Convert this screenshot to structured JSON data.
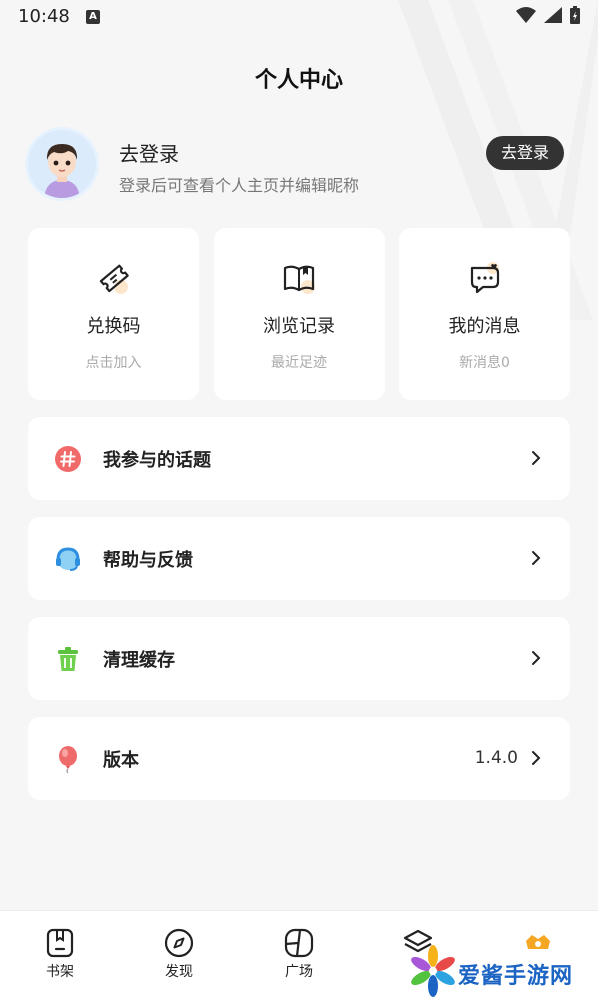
{
  "status_bar": {
    "time": "10:48",
    "notif_badge": "A"
  },
  "page_title": "个人中心",
  "profile": {
    "name": "去登录",
    "subtitle": "登录后可查看个人主页并编辑昵称",
    "login_button": "去登录"
  },
  "cards": [
    {
      "title": "兑换码",
      "subtitle": "点击加入",
      "icon": "ticket-icon"
    },
    {
      "title": "浏览记录",
      "subtitle": "最近足迹",
      "icon": "book-icon"
    },
    {
      "title": "我的消息",
      "subtitle": "新消息0",
      "icon": "message-icon"
    }
  ],
  "menu": [
    {
      "label": "我参与的话题",
      "icon": "hashtag-icon",
      "value": ""
    },
    {
      "label": "帮助与反馈",
      "icon": "headset-icon",
      "value": ""
    },
    {
      "label": "清理缓存",
      "icon": "trash-icon",
      "value": ""
    },
    {
      "label": "版本",
      "icon": "balloon-icon",
      "value": "1.4.0"
    }
  ],
  "tabbar": [
    {
      "label": "书架",
      "icon": "bookshelf-icon"
    },
    {
      "label": "发现",
      "icon": "compass-icon"
    },
    {
      "label": "广场",
      "icon": "square-icon"
    },
    {
      "label": "",
      "icon": "layers-icon"
    },
    {
      "label": "",
      "icon": "profile-icon"
    }
  ],
  "watermark": {
    "text": "爱酱手游网"
  },
  "colors": {
    "accent_orange": "#f5a623",
    "topic_red": "#f06a6a",
    "help_blue": "#3aa0e8",
    "trash_green": "#5bc23f",
    "balloon_red": "#ef6a6a"
  }
}
